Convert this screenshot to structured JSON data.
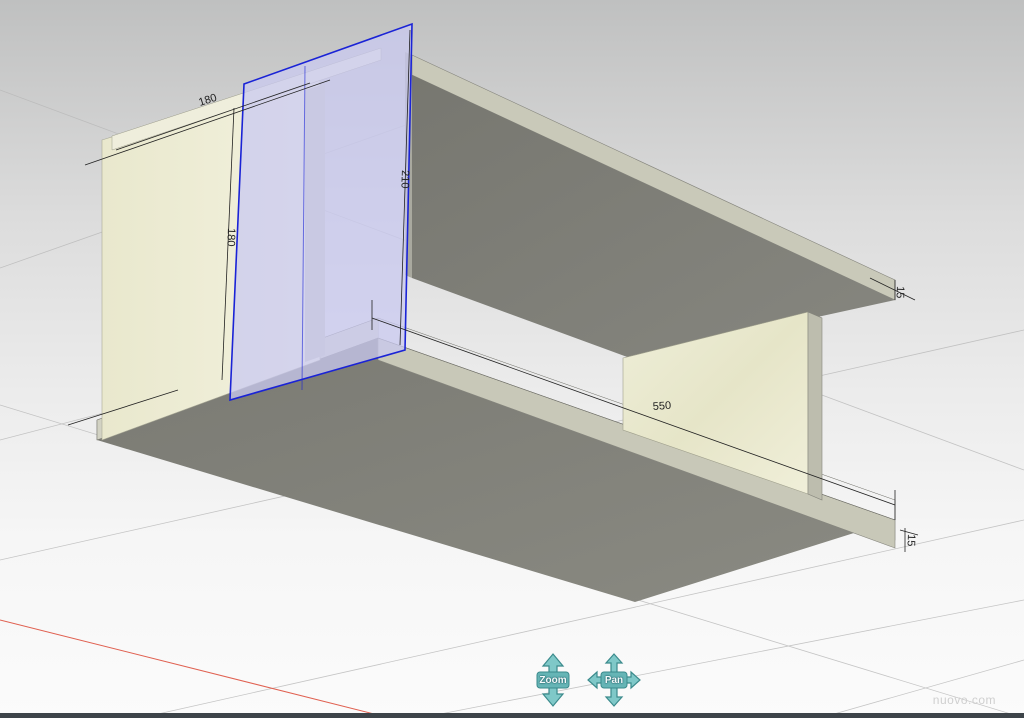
{
  "navigation": {
    "zoom_label": "Zoom",
    "pan_label": "Pan"
  },
  "dimensions": {
    "width_top": "180",
    "height_inner": "180",
    "height_selected": "210",
    "length_bottom": "550",
    "thickness_top": "15",
    "thickness_bottom": "15"
  },
  "watermark": "nuovo.com",
  "colors": {
    "selection": "#1a23d6",
    "selection_fill": "#c9c9f0",
    "board_gray": "#7e7e76",
    "board_edge": "#c8c8b8",
    "wood_panel": "#ecebd2",
    "axis_red": "#e06050"
  },
  "icons": {
    "zoom": "zoom-arrows-icon",
    "pan": "pan-arrows-icon"
  }
}
